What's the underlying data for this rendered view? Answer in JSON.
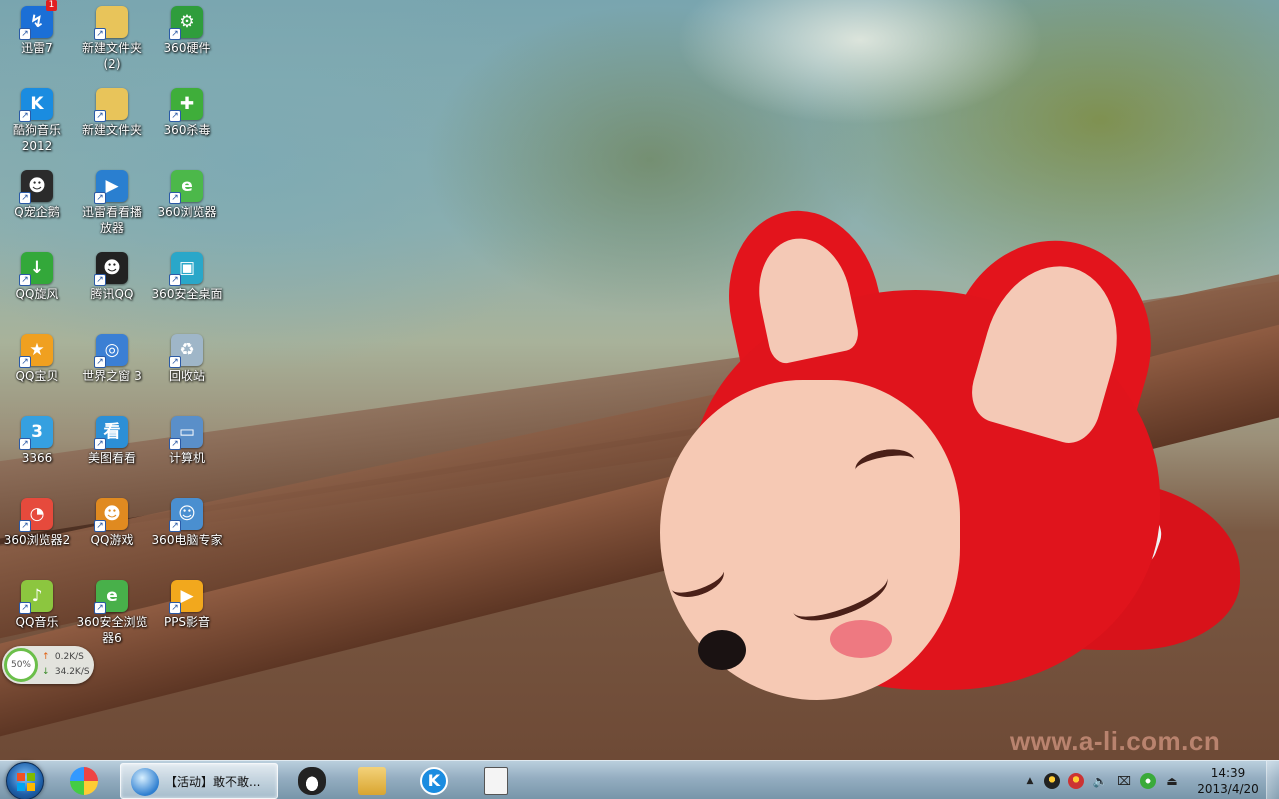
{
  "desktop": {
    "icons": [
      {
        "label": "迅雷7",
        "icon": "xunlei-icon",
        "color": "#1b6fd6",
        "glyph": "↯",
        "badge": "1"
      },
      {
        "label": "新建文件夹\n(2)",
        "icon": "folder-icon",
        "color": "#e8c45a",
        "glyph": ""
      },
      {
        "label": "360硬件",
        "icon": "360-hardware-icon",
        "color": "#2f9d3c",
        "glyph": "⚙"
      },
      {
        "label": "酷狗音乐\n2012",
        "icon": "kugou-icon",
        "color": "#1a8ce0",
        "glyph": "K"
      },
      {
        "label": "新建文件夹",
        "icon": "folder-icon",
        "color": "#e8c45a",
        "glyph": ""
      },
      {
        "label": "360杀毒",
        "icon": "360-antivirus-icon",
        "color": "#3fae3a",
        "glyph": "✚"
      },
      {
        "label": "Q宠企鹅",
        "icon": "penguin-icon",
        "color": "#2b2b2b",
        "glyph": "☻"
      },
      {
        "label": "迅雷看看播\n放器",
        "icon": "kankan-player-icon",
        "color": "#2a7fd0",
        "glyph": "▶"
      },
      {
        "label": "360浏览器",
        "icon": "360-browser-icon",
        "color": "#4cb84a",
        "glyph": "e"
      },
      {
        "label": "QQ旋风",
        "icon": "qq-whirlwind-icon",
        "color": "#33a83a",
        "glyph": "↓"
      },
      {
        "label": "腾讯QQ",
        "icon": "qq-icon",
        "color": "#222222",
        "glyph": "☻"
      },
      {
        "label": "360安全桌面",
        "icon": "360-desktop-icon",
        "color": "#2aa7c9",
        "glyph": "▣"
      },
      {
        "label": "QQ宝贝",
        "icon": "qq-baby-icon",
        "color": "#f0a020",
        "glyph": "★"
      },
      {
        "label": "世界之窗 3",
        "icon": "theworld-browser-icon",
        "color": "#3b7fd4",
        "glyph": "◎"
      },
      {
        "label": "回收站",
        "icon": "recycle-bin-icon",
        "color": "#9fb6c8",
        "glyph": "♻"
      },
      {
        "label": "3366",
        "icon": "3366-icon",
        "color": "#35a0e0",
        "glyph": "3"
      },
      {
        "label": "美图看看",
        "icon": "meitu-viewer-icon",
        "color": "#2c8fd6",
        "glyph": "看"
      },
      {
        "label": "计算机",
        "icon": "computer-icon",
        "color": "#5a8fc9",
        "glyph": "▭"
      },
      {
        "label": "360浏览器2",
        "icon": "360-browser2-icon",
        "color": "#e64a3c",
        "glyph": "◔"
      },
      {
        "label": "QQ游戏",
        "icon": "qq-game-icon",
        "color": "#e08a20",
        "glyph": "☻"
      },
      {
        "label": "360电脑专家",
        "icon": "360-expert-icon",
        "color": "#4a8fd0",
        "glyph": "☺"
      },
      {
        "label": "QQ音乐",
        "icon": "qq-music-icon",
        "color": "#8cc63f",
        "glyph": "♪"
      },
      {
        "label": "360安全浏览\n器6",
        "icon": "360-secure-browser-icon",
        "color": "#48b04a",
        "glyph": "e"
      },
      {
        "label": "PPS影音",
        "icon": "pps-icon",
        "color": "#f2a81d",
        "glyph": "▶"
      }
    ]
  },
  "speed_widget": {
    "percent": "50%",
    "upload": "0.2K/S",
    "download": "34.2K/S",
    "upload_arrow": "↑",
    "download_arrow": "↓"
  },
  "wallpaper": {
    "watermark": "www.a-li.com.cn"
  },
  "taskbar": {
    "start": {
      "icon": "windows-start-icon"
    },
    "pinned": [
      {
        "icon": "colorful-app-icon",
        "color": "#e44"
      },
      {
        "icon": "qq-penguin-icon",
        "color": "#222"
      },
      {
        "icon": "explorer-folder-icon",
        "color": "#e8c45a"
      },
      {
        "icon": "kugou-icon",
        "color": "#1a8ce0"
      },
      {
        "icon": "notepad-icon",
        "color": "#f4f4f4"
      }
    ],
    "active_window": {
      "title": "【活动】敢不敢...",
      "icon": "globe-browser-icon"
    },
    "tray": {
      "icons": [
        "show-hidden-icons-arrow",
        "qq-tray-icon",
        "qq-tray-icon-2",
        "volume-icon",
        "network-icon",
        "360-tray-icon",
        "usb-icon"
      ],
      "expand_glyph": "▲",
      "volume_glyph": "🔈",
      "network_glyph": "⌧",
      "usb_glyph": "⏏"
    },
    "clock": {
      "time": "14:39",
      "date": "2013/4/20"
    }
  },
  "colors": {
    "taskbar_top": "#bed2e1",
    "taskbar_bottom": "#7896aa",
    "fox_red": "#e0141c",
    "fox_face": "#f6c9b4"
  }
}
